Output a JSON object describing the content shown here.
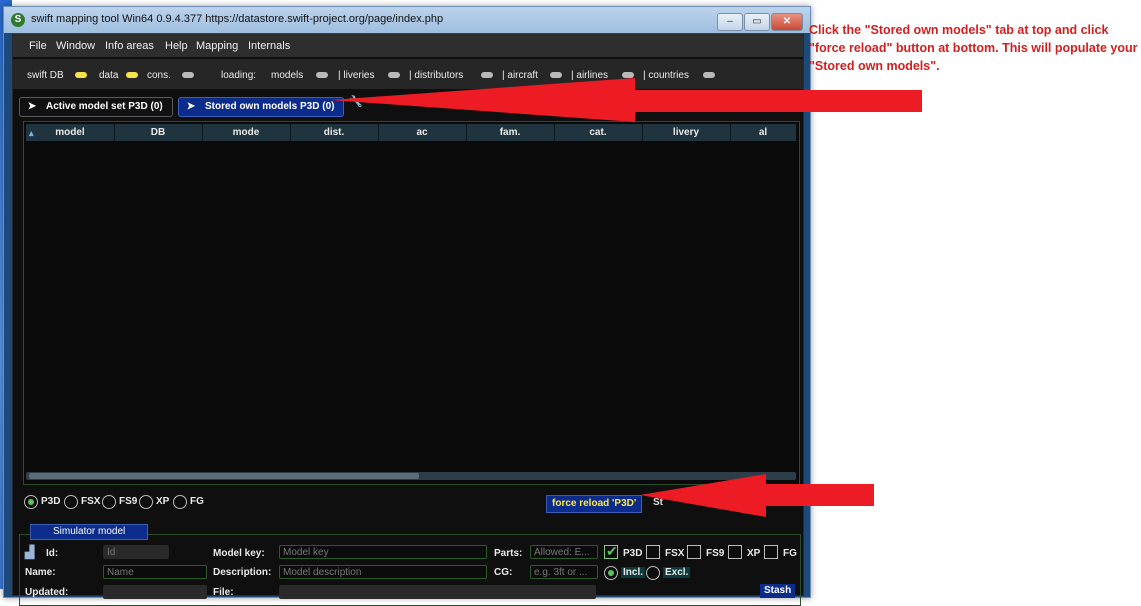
{
  "window": {
    "title": "swift mapping tool Win64 0.9.4.377 https://datastore.swift-project.org/page/index.php",
    "app_icon": "swift-logo-icon",
    "controls": {
      "minimize": "–",
      "maximize": "▭",
      "close": "✕"
    }
  },
  "menu": {
    "items": [
      "File",
      "Window",
      "Info areas",
      "Help",
      "Mapping",
      "Internals"
    ]
  },
  "status": {
    "swift_db": "swift DB",
    "data": "data",
    "cons": "cons.",
    "loading": "loading:",
    "models": "models",
    "liveries": "| liveries",
    "distributors": "| distributors",
    "aircraft": "| aircraft",
    "airlines": "| airlines",
    "countries": "| countries"
  },
  "tabs": {
    "active_model_set": "Active model set P3D (0)",
    "stored_own_models": "Stored own models P3D (0)"
  },
  "table": {
    "columns": [
      "model",
      "DB",
      "mode",
      "dist.",
      "ac",
      "fam.",
      "cat.",
      "livery",
      "al"
    ],
    "rows": []
  },
  "simulators": {
    "options": [
      "P3D",
      "FSX",
      "FS9",
      "XP",
      "FG"
    ],
    "selected": "P3D"
  },
  "actions": {
    "force_reload": "force reload 'P3D'",
    "stash_partial": "St"
  },
  "simulator_model": {
    "section_title": "Simulator model",
    "id_label": "Id:",
    "id_placeholder": "Id",
    "name_label": "Name:",
    "name_placeholder": "Name",
    "updated_label": "Updated:",
    "model_key_label": "Model key:",
    "model_key_placeholder": "Model key",
    "description_label": "Description:",
    "description_placeholder": "Model description",
    "file_label": "File:",
    "parts_label": "Parts:",
    "parts_placeholder": "Allowed: E...",
    "cg_label": "CG:",
    "cg_placeholder": "e.g. 3ft or ...",
    "sim_checks": [
      "P3D",
      "FSX",
      "FS9",
      "XP",
      "FG"
    ],
    "sim_checked": "P3D",
    "incl_label": "Incl.",
    "excl_label": "Excl.",
    "stash_button": "Stash"
  },
  "annotation": {
    "text": "Click the \"Stored own models\" tab at top and click \"force reload\" button at bottom.  This will populate your \"Stored own models\"."
  }
}
